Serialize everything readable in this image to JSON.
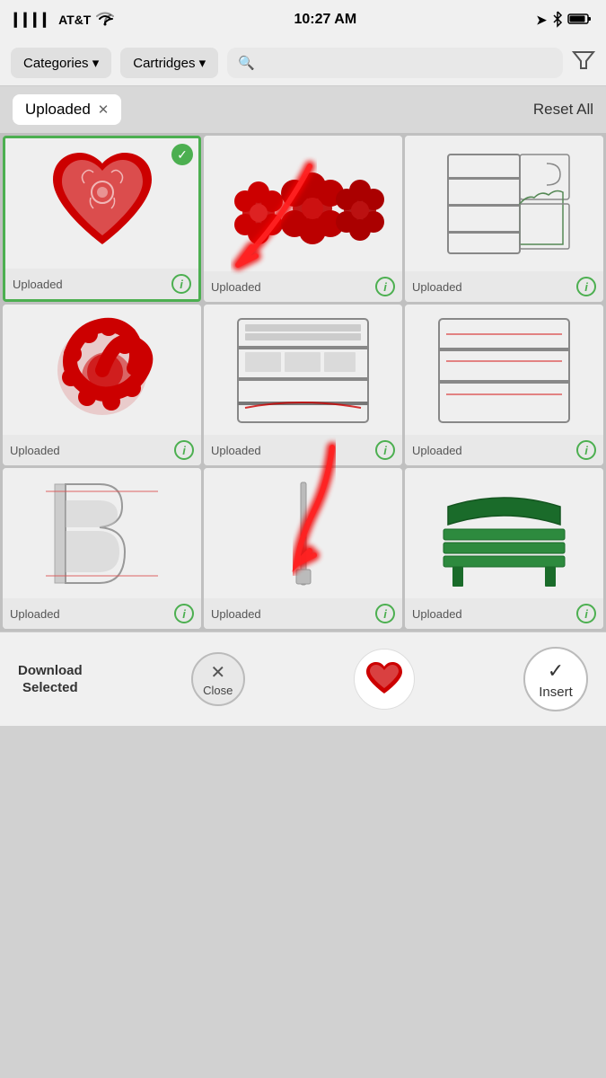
{
  "status_bar": {
    "carrier": "AT&T",
    "time": "10:27 AM",
    "signal": "●●●●",
    "wifi": "wifi",
    "location": "▶",
    "bluetooth": "bluetooth",
    "battery": "battery"
  },
  "nav": {
    "categories_label": "Categories ▾",
    "cartridges_label": "Cartridges ▾",
    "search_placeholder": "🔍",
    "filter_label": "⛉"
  },
  "filter_row": {
    "tag": "Uploaded",
    "reset_label": "Reset All"
  },
  "grid_items": [
    {
      "id": 1,
      "label": "Uploaded",
      "selected": true,
      "type": "heart"
    },
    {
      "id": 2,
      "label": "Uploaded",
      "selected": false,
      "type": "flowers"
    },
    {
      "id": 3,
      "label": "Uploaded",
      "selected": false,
      "type": "shelves1"
    },
    {
      "id": 4,
      "label": "Uploaded",
      "selected": false,
      "type": "spiral"
    },
    {
      "id": 5,
      "label": "Uploaded",
      "selected": false,
      "type": "shelves2"
    },
    {
      "id": 6,
      "label": "Uploaded",
      "selected": false,
      "type": "shelves3"
    },
    {
      "id": 7,
      "label": "Uploaded",
      "selected": false,
      "type": "letter"
    },
    {
      "id": 8,
      "label": "Uploaded",
      "selected": false,
      "type": "stick"
    },
    {
      "id": 9,
      "label": "Uploaded",
      "selected": false,
      "type": "bench"
    }
  ],
  "bottom": {
    "download_label": "Download\nSelected",
    "close_label": "Close",
    "insert_label": "Insert"
  }
}
